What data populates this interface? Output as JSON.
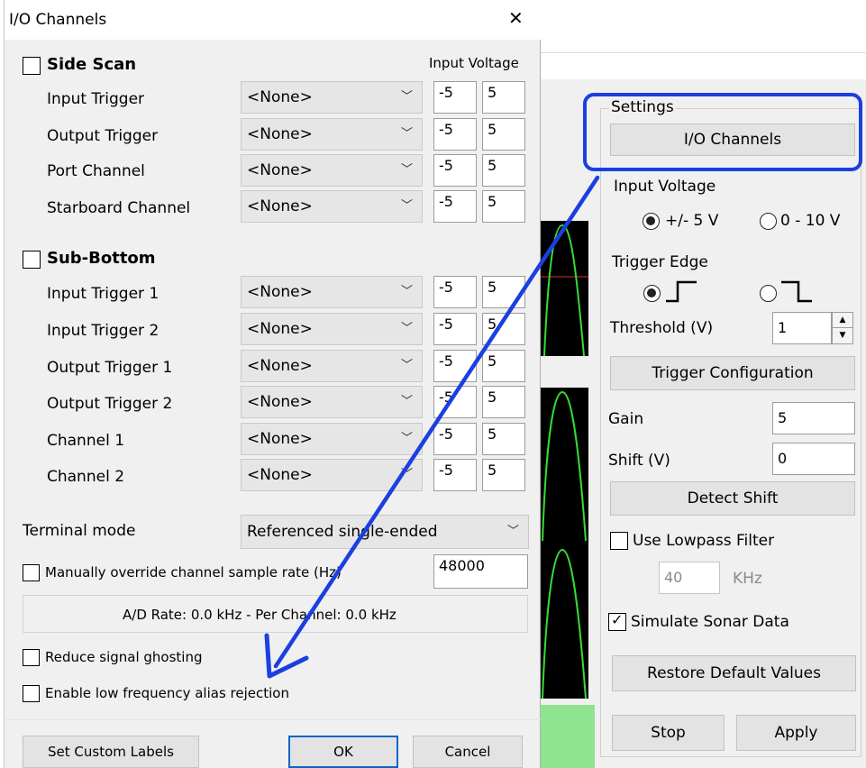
{
  "dialog": {
    "title": "I/O Channels",
    "close_glyph": "✕",
    "input_voltage_header": "Input Voltage",
    "side_scan": {
      "label": "Side Scan",
      "rows": [
        {
          "label": "Input Trigger",
          "value": "<None>",
          "min": "-5",
          "max": "5"
        },
        {
          "label": "Output Trigger",
          "value": "<None>",
          "min": "-5",
          "max": "5"
        },
        {
          "label": "Port Channel",
          "value": "<None>",
          "min": "-5",
          "max": "5"
        },
        {
          "label": "Starboard Channel",
          "value": "<None>",
          "min": "-5",
          "max": "5"
        }
      ]
    },
    "sub_bottom": {
      "label": "Sub-Bottom",
      "rows": [
        {
          "label": "Input Trigger 1",
          "value": "<None>",
          "min": "-5",
          "max": "5"
        },
        {
          "label": "Input Trigger 2",
          "value": "<None>",
          "min": "-5",
          "max": "5"
        },
        {
          "label": "Output Trigger 1",
          "value": "<None>",
          "min": "-5",
          "max": "5"
        },
        {
          "label": "Output Trigger 2",
          "value": "<None>",
          "min": "-5",
          "max": "5"
        },
        {
          "label": "Channel 1",
          "value": "<None>",
          "min": "-5",
          "max": "5"
        },
        {
          "label": "Channel 2",
          "value": "<None>",
          "min": "-5",
          "max": "5"
        }
      ]
    },
    "terminal_mode_label": "Terminal mode",
    "terminal_mode_value": "Referenced single-ended",
    "override_label": "Manually override channel sample rate (Hz)",
    "override_value": "48000",
    "ad_rate": "A/D Rate: 0.0 kHz - Per Channel: 0.0 kHz",
    "reduce_ghosting": "Reduce signal ghosting",
    "alias_rejection": "Enable low frequency alias rejection",
    "set_custom_labels": "Set Custom Labels",
    "ok": "OK",
    "cancel": "Cancel"
  },
  "settings": {
    "group_label": "Settings",
    "io_channels_button": "I/O Channels",
    "input_voltage_label": "Input Voltage",
    "voltage_option_1": "+/- 5 V",
    "voltage_option_2": "0 - 10 V",
    "trigger_edge_label": "Trigger Edge",
    "threshold_label": "Threshold (V)",
    "threshold_value": "1",
    "trigger_config_button": "Trigger Configuration",
    "gain_label": "Gain",
    "gain_value": "5",
    "shift_label": "Shift (V)",
    "shift_value": "0",
    "detect_shift_button": "Detect Shift",
    "lowpass_label": "Use Lowpass Filter",
    "lowpass_value": "40",
    "lowpass_unit": "KHz",
    "simulate_label": "Simulate Sonar Data",
    "restore_button": "Restore Default Values",
    "stop_button": "Stop",
    "apply_button": "Apply"
  },
  "colors": {
    "highlight": "#1b3fe0",
    "wave": "#33dd33",
    "ok_border": "#0a64c8",
    "status_bar": "#8fe58f"
  }
}
